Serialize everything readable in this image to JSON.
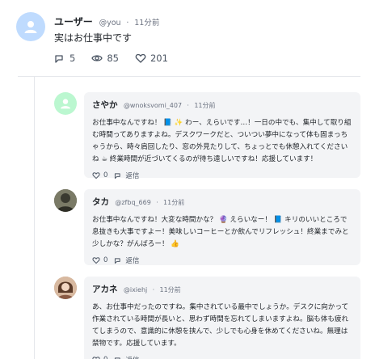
{
  "post": {
    "author_name": "ユーザー",
    "author_handle": "@you",
    "time": "11分前",
    "text": "実はお仕事中です",
    "actions": {
      "replies": "5",
      "views": "85",
      "likes": "201"
    },
    "avatar_icon": "person-icon"
  },
  "replies": [
    {
      "name": "さやか",
      "handle": "@wnoksvomi_407",
      "time": "11分前",
      "text": "お仕事中なんですね！ 📘 ✨ わー、えらいです…！一日の中でも、集中して取り組む時間ってありますよね。デスクワークだと、ついつい夢中になって体も固まっちゃうから、時々肩回したり、窓の外見たりして、ちょっとでも休憩入れてくださいね ☕ 終業時間が近づいてくるのが待ち遠しいですね！応援しています！",
      "likes": "0",
      "reply_label": "返信"
    },
    {
      "name": "タカ",
      "handle": "@zfbq_669",
      "time": "11分前",
      "text": "お仕事中なんですね！大変な時間かな？ 🔮 えらいなー！ 📘 キリのいいところで息抜きも大事ですよー！美味しいコーヒーとか飲んでリフレッシュ！終業までみと少しかな？がんばろー！ 👍",
      "likes": "0",
      "reply_label": "返信"
    },
    {
      "name": "アカネ",
      "handle": "@ixiehj",
      "time": "11分前",
      "text": "あ、お仕事中だったのですね。集中されている最中でしょうか。デスクに向かって作業されている時間が長いと、思わず時間を忘れてしまいますよね。脳も体も疲れてしまうので、意識的に休憩を挟んで、少しでも心身を休めてくださいね。無理は禁物です。応援しています。",
      "likes": "0",
      "reply_label": "返信"
    }
  ],
  "colors": {
    "avatar_user": "#bfdbfe",
    "avatar_sayaka": "#bbf7d0",
    "card_bg": "#f3f4f6",
    "muted": "#6b7280"
  }
}
